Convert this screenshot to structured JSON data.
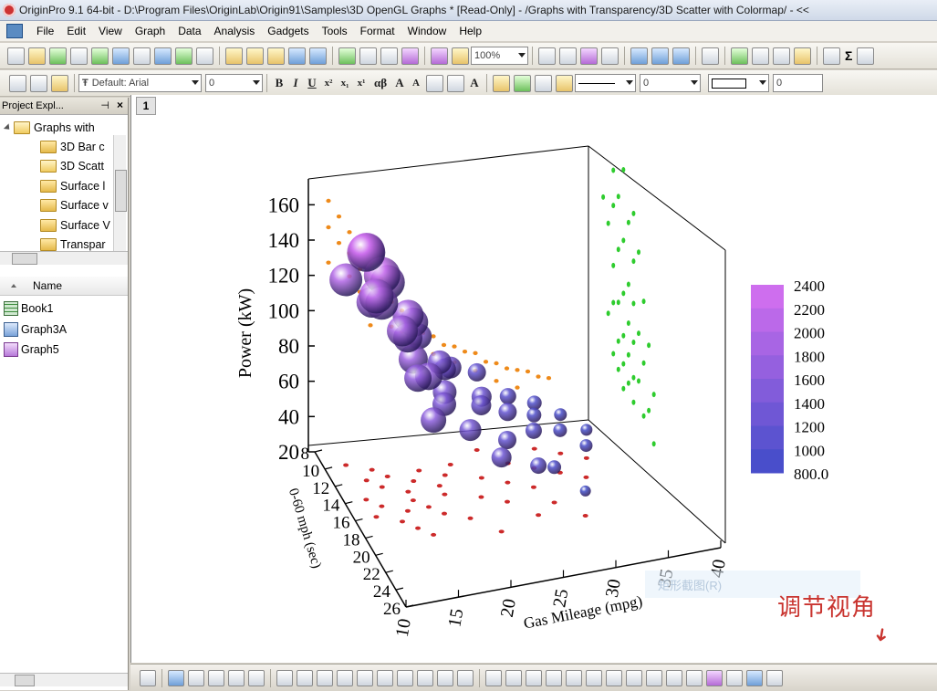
{
  "window": {
    "title": "OriginPro 9.1 64-bit - D:\\Program Files\\OriginLab\\Origin91\\Samples\\3D OpenGL Graphs * [Read-Only] - /Graphs with Transparency/3D Scatter with Colormap/ - <<"
  },
  "menu": [
    "File",
    "Edit",
    "View",
    "Graph",
    "Data",
    "Analysis",
    "Gadgets",
    "Tools",
    "Format",
    "Window",
    "Help"
  ],
  "toolbar": {
    "zoom": "100%",
    "font_name": "Default: Arial",
    "font_size": "0",
    "line_width": "0",
    "border_value": "0",
    "sigma_label": "Σ"
  },
  "project_explorer": {
    "title": "Project Expl...",
    "root_folder": "Graphs with",
    "folders": [
      "3D Bar c",
      "3D Scatt",
      "Surface l",
      "Surface v",
      "Surface V",
      "Transpar"
    ],
    "list_header": "Name",
    "items": [
      {
        "name": "Book1",
        "type": "book"
      },
      {
        "name": "Graph3A",
        "type": "graph"
      },
      {
        "name": "Graph5",
        "type": "graph"
      }
    ]
  },
  "graph": {
    "page_tab": "1",
    "context_menu_item": "矩形截图(R)",
    "annotation": "调节视角"
  },
  "colors": {
    "top_bubbles": "#b070e0",
    "bottom_bubbles": "#4a58c8",
    "z_projection": "#ee8a1a",
    "x_projection": "#cc2a2a",
    "yz_projection": "#2ecc2e",
    "colormap_low": "#3f4cc8",
    "colormap_high": "#ff80f0"
  },
  "chart_data": {
    "type": "scatter",
    "subtype": "3d-bubble-colormap",
    "zlabel": "Power (kW)",
    "xlabel": "Gas Mileage (mpg)",
    "ylabel": "0-60 mph (sec)",
    "z_ticks": [
      "20",
      "40",
      "60",
      "80",
      "100",
      "120",
      "140",
      "160"
    ],
    "y_ticks": [
      "8",
      "10",
      "12",
      "14",
      "16",
      "18",
      "20",
      "22",
      "24",
      "26"
    ],
    "x_ticks": [
      "10",
      "15",
      "20",
      "25",
      "30",
      "35",
      "40"
    ],
    "zlim": [
      20,
      170
    ],
    "ylim": [
      8,
      26
    ],
    "xlim": [
      10,
      40
    ],
    "colormap": {
      "levels": [
        "2400",
        "2200",
        "2000",
        "1800",
        "1600",
        "1400",
        "1200",
        "1000",
        "800.0"
      ],
      "range": [
        800,
        2400
      ]
    },
    "series": [
      {
        "x": [
          12,
          13,
          12,
          14,
          13,
          15,
          14,
          12,
          16,
          15,
          14,
          17,
          15,
          16,
          18,
          17,
          19,
          16,
          18,
          20,
          19,
          21,
          22,
          20,
          23,
          24,
          22,
          25,
          26,
          24,
          27,
          28,
          26,
          29,
          30,
          31,
          28,
          32,
          33,
          30
        ],
        "y": [
          14,
          12,
          16,
          13,
          15,
          12,
          17,
          10,
          14,
          16,
          11,
          13,
          18,
          15,
          12,
          16,
          14,
          19,
          17,
          13,
          15,
          12,
          16,
          18,
          14,
          11,
          20,
          15,
          13,
          17,
          16,
          14,
          19,
          12,
          15,
          13,
          18,
          16,
          14,
          20
        ],
        "z": [
          160,
          150,
          145,
          140,
          135,
          130,
          128,
          125,
          120,
          118,
          115,
          110,
          105,
          100,
          96,
          94,
          90,
          85,
          82,
          80,
          78,
          75,
          72,
          70,
          66,
          64,
          62,
          60,
          58,
          55,
          52,
          50,
          48,
          46,
          44,
          42,
          40,
          38,
          36,
          34
        ],
        "weight": [
          2300,
          2200,
          2100,
          2200,
          2000,
          2100,
          1900,
          2000,
          1900,
          1800,
          1900,
          1800,
          1700,
          1800,
          1600,
          1700,
          1500,
          1600,
          1500,
          1400,
          1500,
          1400,
          1300,
          1400,
          1300,
          1200,
          1300,
          1200,
          1100,
          1200,
          1100,
          1000,
          1100,
          1000,
          950,
          900,
          950,
          900,
          850,
          800
        ]
      }
    ]
  }
}
